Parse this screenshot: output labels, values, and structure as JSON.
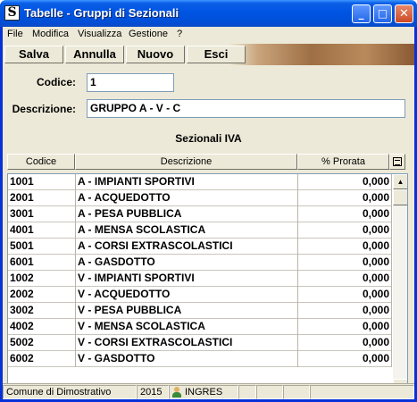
{
  "window": {
    "title": "Tabelle - Gruppi di Sezionali",
    "app_icon": "S"
  },
  "menu": [
    "File",
    "Modifica",
    "Visualizza",
    "Gestione",
    "?"
  ],
  "toolbar": {
    "salva": "Salva",
    "annulla": "Annulla",
    "nuovo": "Nuovo",
    "esci": "Esci"
  },
  "form": {
    "codice_label": "Codice:",
    "codice_value": "1",
    "descrizione_label": "Descrizione:",
    "descrizione_value": "GRUPPO A - V - C"
  },
  "section_title": "Sezionali IVA",
  "table": {
    "columns": [
      "Codice",
      "Descrizione",
      "% Prorata"
    ],
    "rows": [
      [
        "1001",
        "A - IMPIANTI SPORTIVI",
        "0,000"
      ],
      [
        "2001",
        "A - ACQUEDOTTO",
        "0,000"
      ],
      [
        "3001",
        "A - PESA PUBBLICA",
        "0,000"
      ],
      [
        "4001",
        "A - MENSA SCOLASTICA",
        "0,000"
      ],
      [
        "5001",
        "A - CORSI EXTRASCOLASTICI",
        "0,000"
      ],
      [
        "6001",
        "A - GASDOTTO",
        "0,000"
      ],
      [
        "1002",
        "V - IMPIANTI SPORTIVI",
        "0,000"
      ],
      [
        "2002",
        "V - ACQUEDOTTO",
        "0,000"
      ],
      [
        "3002",
        "V - PESA PUBBLICA",
        "0,000"
      ],
      [
        "4002",
        "V - MENSA SCOLASTICA",
        "0,000"
      ],
      [
        "5002",
        "V - CORSI EXTRASCOLASTICI",
        "0,000"
      ],
      [
        "6002",
        "V - GASDOTTO",
        "0,000"
      ]
    ]
  },
  "status": {
    "comune": "Comune di Dimostrativo",
    "year": "2015",
    "user": "INGRES"
  }
}
